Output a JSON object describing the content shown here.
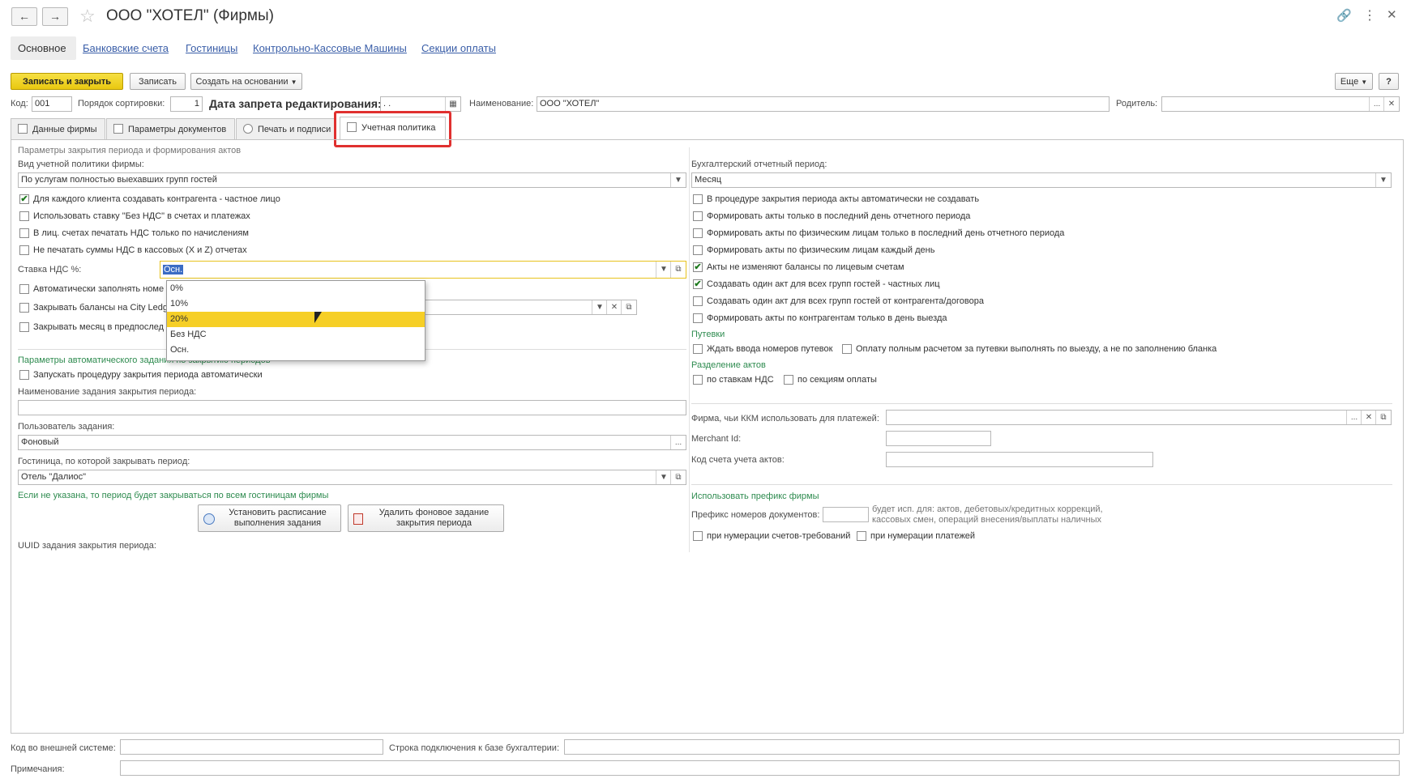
{
  "window": {
    "title": "ООО \"ХОТЕЛ\" (Фирмы)"
  },
  "nav_tabs": [
    "Основное",
    "Банковские счета",
    "Гостиницы",
    "Контрольно-Кассовые Машины",
    "Секции оплаты"
  ],
  "toolbar": {
    "save_close": "Записать и закрыть",
    "save": "Записать",
    "create_based": "Создать на основании",
    "more": "Еще",
    "help": "?"
  },
  "fields": {
    "code_label": "Код:",
    "code_value": "001",
    "sort_label": "Порядок сортировки:",
    "sort_value": "1",
    "lock_date_label": "Дата запрета редактирования:",
    "lock_date_value": ". .",
    "name_label": "Наименование:",
    "name_value": "ООО \"ХОТЕЛ\"",
    "parent_label": "Родитель:",
    "parent_value": ""
  },
  "tabs": [
    "Данные фирмы",
    "Параметры документов",
    "Печать и подписи",
    "Учетная политика"
  ],
  "left": {
    "section1": "Параметры закрытия периода и формирования актов",
    "policy_label": "Вид учетной политики фирмы:",
    "policy_value": "По услугам полностью выехавших групп гостей",
    "checks": [
      {
        "label": "Для каждого клиента создавать контрагента - частное лицо",
        "checked": true
      },
      {
        "label": "Использовать ставку \"Без НДС\" в счетах и платежах",
        "checked": false
      },
      {
        "label": "В лиц. счетах печатать НДС только по начислениям",
        "checked": false
      },
      {
        "label": "Не печатать суммы НДС в кассовых (X и Z) отчетах",
        "checked": false
      }
    ],
    "vat_label": "Ставка НДС %:",
    "vat_value": "Осн.",
    "checks2": [
      {
        "label": "Автоматически заполнять номе",
        "checked": false
      },
      {
        "label": "Закрывать балансы на City Ledg",
        "checked": false
      },
      {
        "label": "Закрывать месяц в предпослед",
        "checked": false
      }
    ],
    "section2": "Параметры автоматического задания по закрытию периодов",
    "auto_check": "Запускать процедуру закрытия периода автоматически",
    "task_name_label": "Наименование задания закрытия периода:",
    "task_name_value": "",
    "task_user_label": "Пользователь задания:",
    "task_user_value": "Фоновый",
    "hotel_label": "Гостиница, по которой закрывать период:",
    "hotel_value": "Отель \"Далиос\"",
    "hotel_hint": "Если не указана, то период будет закрываться по всем гостиницам фирмы",
    "btn_schedule": "Установить расписание выполнения задания",
    "btn_delete": "Удалить фоновое задание закрытия периода",
    "uuid_label": "UUID задания закрытия периода:"
  },
  "dropdown": {
    "options": [
      "0%",
      "10%",
      "20%",
      "Без НДС",
      "Осн."
    ],
    "selected_index": 2
  },
  "right": {
    "period_label": "Бухгалтерский отчетный период:",
    "period_value": "Месяц",
    "checks": [
      {
        "label": "В процедуре закрытия периода акты автоматически не создавать",
        "checked": false
      },
      {
        "label": "Формировать акты только в последний день отчетного периода",
        "checked": false
      },
      {
        "label": "Формировать акты по физическим лицам только в последний день отчетного периода",
        "checked": false
      },
      {
        "label": "Формировать акты по физическим лицам каждый день",
        "checked": false
      },
      {
        "label": "Акты не изменяют балансы по лицевым счетам",
        "checked": true
      },
      {
        "label": "Создавать один акт для всех групп гостей - частных лиц",
        "checked": true
      },
      {
        "label": "Создавать один акт для всех групп гостей от контрагента/договора",
        "checked": false
      },
      {
        "label": "Формировать акты по контрагентам только в день выезда",
        "checked": false
      }
    ],
    "vouchers_section": "Путевки",
    "voucher_check1": "Ждать ввода номеров путевок",
    "voucher_check2": "Оплату полным расчетом за путевки выполнять по выезду, а не по заполнению бланка",
    "split_section": "Разделение актов",
    "split_check1": "по ставкам НДС",
    "split_check2": "по секциям оплаты",
    "kkm_label": "Фирма, чьи ККМ использовать для платежей:",
    "kkm_value": "",
    "merchant_label": "Merchant Id:",
    "merchant_value": "",
    "account_label": "Код счета учета актов:",
    "account_value": "",
    "prefix_section": "Использовать префикс фирмы",
    "prefix_label": "Префикс номеров документов:",
    "prefix_value": "",
    "prefix_hint1": "будет исп. для: актов, дебетовых/кредитных коррекций,",
    "prefix_hint2": "кассовых смен, операций внесения/выплаты наличных",
    "prefix_check1": "при нумерации счетов-требований",
    "prefix_check2": "при нумерации платежей"
  },
  "footer": {
    "ext_code_label": "Код во внешней системе:",
    "ext_code_value": "",
    "conn_label": "Строка подключения к базе бухгалтерии:",
    "conn_value": "",
    "notes_label": "Примечания:",
    "notes_value": ""
  }
}
